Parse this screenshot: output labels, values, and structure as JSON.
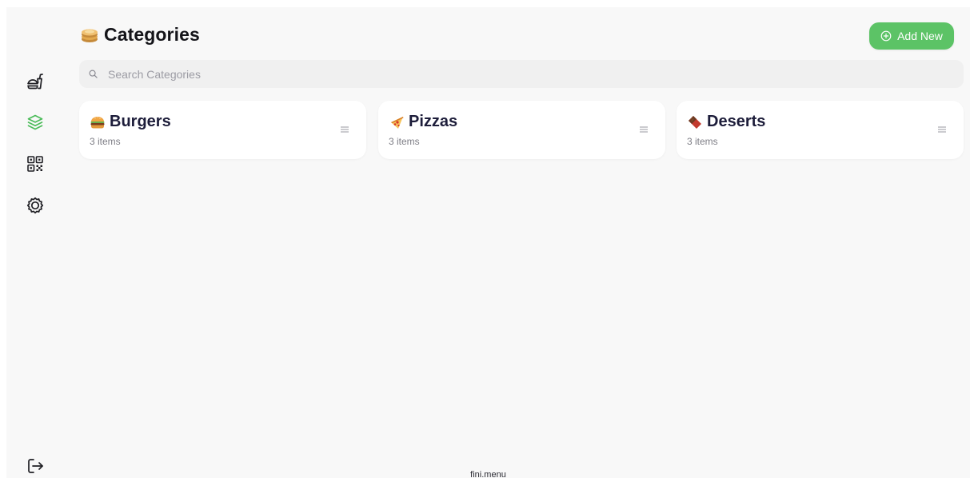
{
  "header": {
    "title": "Categories",
    "title_icon": "pancake-icon",
    "add_button_label": "Add New"
  },
  "search": {
    "placeholder": "Search Categories",
    "value": ""
  },
  "sidebar": {
    "items": [
      {
        "name": "food-menu",
        "icon": "fast-food-icon",
        "active": false
      },
      {
        "name": "categories",
        "icon": "layers-icon",
        "active": true
      },
      {
        "name": "qr-code",
        "icon": "qr-code-icon",
        "active": false
      },
      {
        "name": "settings",
        "icon": "gear-icon",
        "active": false
      }
    ],
    "logout_icon": "logout-icon"
  },
  "categories": [
    {
      "name": "Burgers",
      "count": "3 items",
      "icon": "burger-icon"
    },
    {
      "name": "Pizzas",
      "count": "3 items",
      "icon": "pizza-icon"
    },
    {
      "name": "Deserts",
      "count": "3 items",
      "icon": "chocolate-icon"
    }
  ],
  "footer": {
    "text": "fini.menu"
  },
  "colors": {
    "accent": "#5cc366",
    "background": "#f8f8f8",
    "card": "#ffffff",
    "search_bg": "#f0f0f0",
    "text_dark": "#1d1d3a"
  }
}
